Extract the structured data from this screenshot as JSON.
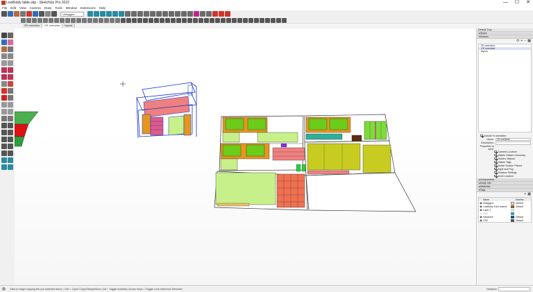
{
  "window": {
    "title": "LowBoldy table.skp - SketchUp Pro 2022",
    "controls": [
      "—",
      "☐",
      "✕"
    ]
  },
  "menu": [
    "File",
    "Edit",
    "View",
    "Camera",
    "Draw",
    "Tools",
    "Window",
    "Extensions",
    "Help"
  ],
  "toolbar": {
    "tag_select_value": "Untagged",
    "colors": {
      "blue": "#2f6fb8",
      "red": "#d0352b",
      "gray": "#6b6b6b",
      "teal": "#2a8aa0",
      "magenta": "#c2268f"
    }
  },
  "scene_tabs": [
    "2D overview",
    "CE overview",
    "layout"
  ],
  "active_scene_tab": 1,
  "tray": {
    "title": "Default Tray",
    "sections": {
      "styles": "Styles",
      "scenes": "Scenes",
      "components": "Components",
      "entity_info": "Entity Info",
      "materials": "Materials",
      "tags": "Tags"
    },
    "scene_list": [
      "2D overview",
      "CE overview",
      "layout"
    ],
    "selected_scene": 1,
    "include_in_animation": "Include in animation",
    "name_label": "Name:",
    "name_value": "CE overview",
    "description_label": "Description:",
    "description_value": "",
    "properties_label": "Properties to save:",
    "properties": [
      {
        "label": "Camera Location",
        "checked": true
      },
      {
        "label": "Visible Hidden Geometry",
        "checked": true
      },
      {
        "label": "Hidden Objects",
        "checked": true
      },
      {
        "label": "Visible Tags",
        "checked": true
      },
      {
        "label": "Active Section Planes",
        "checked": true
      },
      {
        "label": "Style and Fog",
        "checked": true
      },
      {
        "label": "Shadow Settings",
        "checked": true
      },
      {
        "label": "Axes Location",
        "checked": true
      }
    ],
    "tags_header": {
      "name": "Name",
      "dashes": "Dashes"
    },
    "tags": [
      {
        "name": "Untagged",
        "color": "#ffffff",
        "dashes": "Default"
      },
      {
        "name": "LowBoldy 8 full boards",
        "color": "#8a5a2b",
        "dashes": "Default"
      },
      {
        "name": "Layer 1",
        "color": "#d9d9d9",
        "dashes": ""
      },
      {
        "name": "Plan",
        "color": "#3aa0a0",
        "dashes": ""
      },
      {
        "name": "Hardware",
        "color": "#2c4f7a",
        "dashes": "Default"
      },
      {
        "name": "CNC",
        "color": "#555555",
        "dashes": "Default"
      }
    ]
  },
  "status": {
    "message": "Click to begin copying the pre-selected items. | Ctrl = Cycle Copy/Stamp/Move | Alt = Toggle Autofold | Arrow Keys = Toggle Lock Inference Direction",
    "distance_label": "Distance"
  }
}
